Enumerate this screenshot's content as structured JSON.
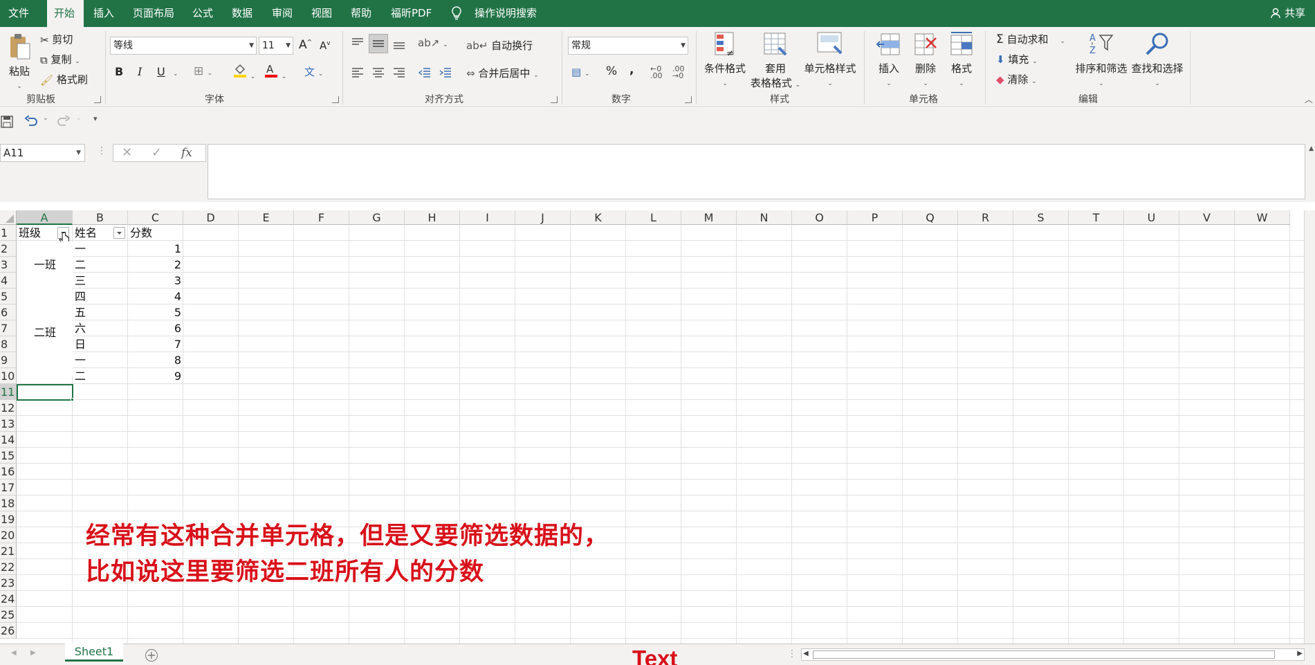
{
  "tabs": [
    "文件",
    "开始",
    "插入",
    "页面布局",
    "公式",
    "数据",
    "审阅",
    "视图",
    "帮助",
    "福昕PDF"
  ],
  "active_tab": "开始",
  "tell_me": "操作说明搜索",
  "share": "共享",
  "clipboard": {
    "paste": "粘贴",
    "cut": "剪切",
    "copy": "复制",
    "format_painter": "格式刷",
    "group": "剪贴板"
  },
  "font": {
    "name": "等线",
    "size": "11",
    "group": "字体",
    "bold": "B",
    "italic": "I",
    "underline": "U"
  },
  "alignment": {
    "wrap": "自动换行",
    "merge": "合并后居中",
    "group": "对齐方式"
  },
  "number": {
    "format": "常规",
    "group": "数字",
    "percent": "%",
    "comma": ","
  },
  "styles": {
    "conditional": "条件格式",
    "table1": "套用",
    "table2": "表格格式",
    "cell_styles": "单元格样式",
    "group": "样式"
  },
  "cells": {
    "insert": "插入",
    "delete": "删除",
    "format": "格式",
    "group": "单元格"
  },
  "editing": {
    "autosum": "自动求和",
    "fill": "填充",
    "clear": "清除",
    "sort_filter": "排序和筛选",
    "find_select": "查找和选择",
    "group": "编辑"
  },
  "name_box": "A11",
  "fx": "fx",
  "columns": [
    "A",
    "B",
    "C",
    "D",
    "E",
    "F",
    "G",
    "H",
    "I",
    "J",
    "K",
    "L",
    "M",
    "N",
    "O",
    "P",
    "Q",
    "R",
    "S",
    "T",
    "U",
    "V",
    "W"
  ],
  "rows": [
    "1",
    "2",
    "3",
    "4",
    "5",
    "6",
    "7",
    "8",
    "9",
    "10",
    "11",
    "12",
    "13",
    "14",
    "15",
    "16",
    "17",
    "18",
    "19",
    "20",
    "21",
    "22",
    "23",
    "24",
    "25",
    "26"
  ],
  "headers": {
    "a": "班级",
    "b": "姓名",
    "c": "分数"
  },
  "merged_a": {
    "class1": "一班",
    "class2": "二班"
  },
  "names": [
    "一",
    "二",
    "三",
    "四",
    "五",
    "六",
    "日",
    "一",
    "二"
  ],
  "scores": [
    "1",
    "2",
    "3",
    "4",
    "5",
    "6",
    "7",
    "8",
    "9"
  ],
  "caption": {
    "line1": "经常有这种合并单元格，但是又要筛选数据的，",
    "line2": "比如说这里要筛选二班所有人的分数"
  },
  "sheet_tab": "Sheet1",
  "watermark": "Text",
  "colors": {
    "accent": "#217346",
    "caption": "#d9111a"
  }
}
